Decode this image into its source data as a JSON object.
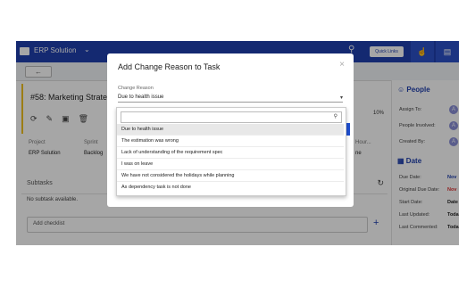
{
  "app": {
    "title": "ERP Solution",
    "quick_links": "Quick Links"
  },
  "task": {
    "title": "#58: Marketing Strate",
    "progress": "10%"
  },
  "meta": {
    "project_label": "Project",
    "project_value": "ERP Solution",
    "sprint_label": "Sprint",
    "sprint_value": "Backlog",
    "hours_label": "Hour...",
    "other_value": "ne"
  },
  "subtasks": {
    "title": "Subtasks",
    "empty": "No subtask available."
  },
  "checklist": {
    "placeholder": "Add checklist"
  },
  "people": {
    "title": "People",
    "rows": [
      {
        "label": "Assign To:",
        "avatar": "A"
      },
      {
        "label": "People Involved:",
        "avatar": "A"
      },
      {
        "label": "Created By:",
        "avatar": "A"
      }
    ]
  },
  "date": {
    "title": "Date",
    "rows": [
      {
        "label": "Due Date:",
        "value": "Nov"
      },
      {
        "label": "Original Due Date:",
        "value": "Nov"
      },
      {
        "label": "Start Date:",
        "value": "Date"
      },
      {
        "label": "Last Updated:",
        "value": "Toda"
      },
      {
        "label": "Last Commented:",
        "value": "Toda"
      }
    ]
  },
  "modal": {
    "title": "Add Change Reason to Task",
    "field_label": "Change Reason",
    "selected": "Due to health issue",
    "options": [
      "Due to health issue",
      "The estimation was wrong",
      "Lack of understanding of the requirement spec",
      "I was on leave",
      "We have not considered the holidays while planning",
      "As dependency task is not done"
    ]
  },
  "colors": {
    "brand": "#1f3fae",
    "accent": "#f0c020"
  }
}
